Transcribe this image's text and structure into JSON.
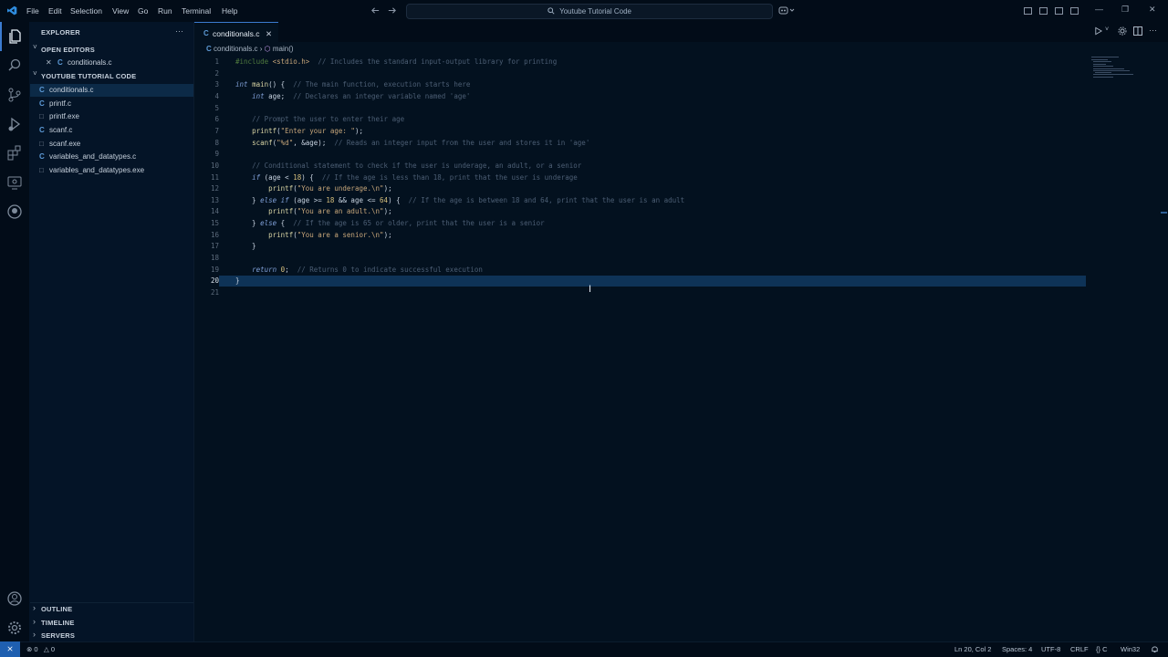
{
  "titlebar": {
    "menu": [
      "File",
      "Edit",
      "Selection",
      "View",
      "Go",
      "Run",
      "Terminal",
      "Help"
    ],
    "search_text": "Youtube Tutorial Code"
  },
  "sidebar": {
    "header": "EXPLORER",
    "more": "···",
    "open_editors_label": "OPEN EDITORS",
    "open_editors": [
      {
        "close": "✕",
        "icon": "C",
        "name": "conditionals.c"
      }
    ],
    "folder_label": "YOUTUBE TUTORIAL CODE",
    "files": [
      {
        "icon": "C",
        "name": "conditionals.c"
      },
      {
        "icon": "C",
        "name": "printf.c"
      },
      {
        "icon": "□",
        "name": "printf.exe"
      },
      {
        "icon": "C",
        "name": "scanf.c"
      },
      {
        "icon": "□",
        "name": "scanf.exe"
      },
      {
        "icon": "C",
        "name": "variables_and_datatypes.c"
      },
      {
        "icon": "□",
        "name": "variables_and_datatypes.exe"
      }
    ],
    "outline": "OUTLINE",
    "timeline": "TIMELINE",
    "servers": "SERVERS",
    "chevron_right": "›",
    "chevron_down": "˅"
  },
  "editor": {
    "tab_icon": "C",
    "tab_label": "conditionals.c",
    "tab_close": "✕",
    "breadcrumb_icon": "C",
    "breadcrumb_file": "conditionals.c",
    "breadcrumb_sep": "›",
    "breadcrumb_symbol": "main()",
    "cursor_glyph": "I",
    "lines": [
      {
        "n": "1",
        "html": "<span class=\"inc\">#include</span> <span class=\"str\">&lt;stdio.h&gt;</span>  <span class=\"cmt\">// Includes the standard input-output library for printing</span>"
      },
      {
        "n": "2",
        "html": ""
      },
      {
        "n": "3",
        "html": "<span class=\"kw\">int</span> <span class=\"fn\">main</span>() {  <span class=\"cmt\">// The main function, execution starts here</span>"
      },
      {
        "n": "4",
        "html": "    <span class=\"kw\">int</span> age;  <span class=\"cmt\">// Declares an integer variable named 'age'</span>"
      },
      {
        "n": "5",
        "html": ""
      },
      {
        "n": "6",
        "html": "    <span class=\"cmt\">// Prompt the user to enter their age</span>"
      },
      {
        "n": "7",
        "html": "    <span class=\"fn\">printf</span>(<span class=\"str\">\"Enter your age: \"</span>);"
      },
      {
        "n": "8",
        "html": "    <span class=\"fn\">scanf</span>(<span class=\"str\">\"%d\"</span>, &amp;age);  <span class=\"cmt\">// Reads an integer input from the user and stores it in 'age'</span>"
      },
      {
        "n": "9",
        "html": ""
      },
      {
        "n": "10",
        "html": "    <span class=\"cmt\">// Conditional statement to check if the user is underage, an adult, or a senior</span>"
      },
      {
        "n": "11",
        "html": "    <span class=\"kw\">if</span> (age &lt; <span class=\"num\">18</span>) {  <span class=\"cmt\">// If the age is less than 18, print that the user is underage</span>"
      },
      {
        "n": "12",
        "html": "        <span class=\"fn\">printf</span>(<span class=\"str\">\"You are underage.\\n\"</span>);"
      },
      {
        "n": "13",
        "html": "    } <span class=\"kw\">else if</span> (age &gt;= <span class=\"num\">18</span> &amp;&amp; age &lt;= <span class=\"num\">64</span>) {  <span class=\"cmt\">// If the age is between 18 and 64, print that the user is an adult</span>"
      },
      {
        "n": "14",
        "html": "        <span class=\"fn\">printf</span>(<span class=\"str\">\"You are an adult.\\n\"</span>);"
      },
      {
        "n": "15",
        "html": "    } <span class=\"kw\">else</span> {  <span class=\"cmt\">// If the age is 65 or older, print that the user is a senior</span>"
      },
      {
        "n": "16",
        "html": "        <span class=\"fn\">printf</span>(<span class=\"str\">\"You are a senior.\\n\"</span>);"
      },
      {
        "n": "17",
        "html": "    }"
      },
      {
        "n": "18",
        "html": ""
      },
      {
        "n": "19",
        "html": "    <span class=\"kw\">return</span> <span class=\"num\">0</span>;  <span class=\"cmt\">// Returns 0 to indicate successful execution</span>"
      },
      {
        "n": "20",
        "html": "}"
      },
      {
        "n": "21",
        "html": ""
      }
    ]
  },
  "statusbar": {
    "remote": "⨯",
    "errors": "⊗ 0",
    "warnings": "△ 0",
    "position": "Ln 20, Col 2",
    "spaces": "Spaces: 4",
    "encoding": "UTF-8",
    "eol": "CRLF",
    "language": "{} C",
    "platform": "Win32",
    "bell": "🔔"
  },
  "colors": {
    "accent": "#3b7bd0",
    "background": "#03111f",
    "selection": "#0e3357"
  }
}
